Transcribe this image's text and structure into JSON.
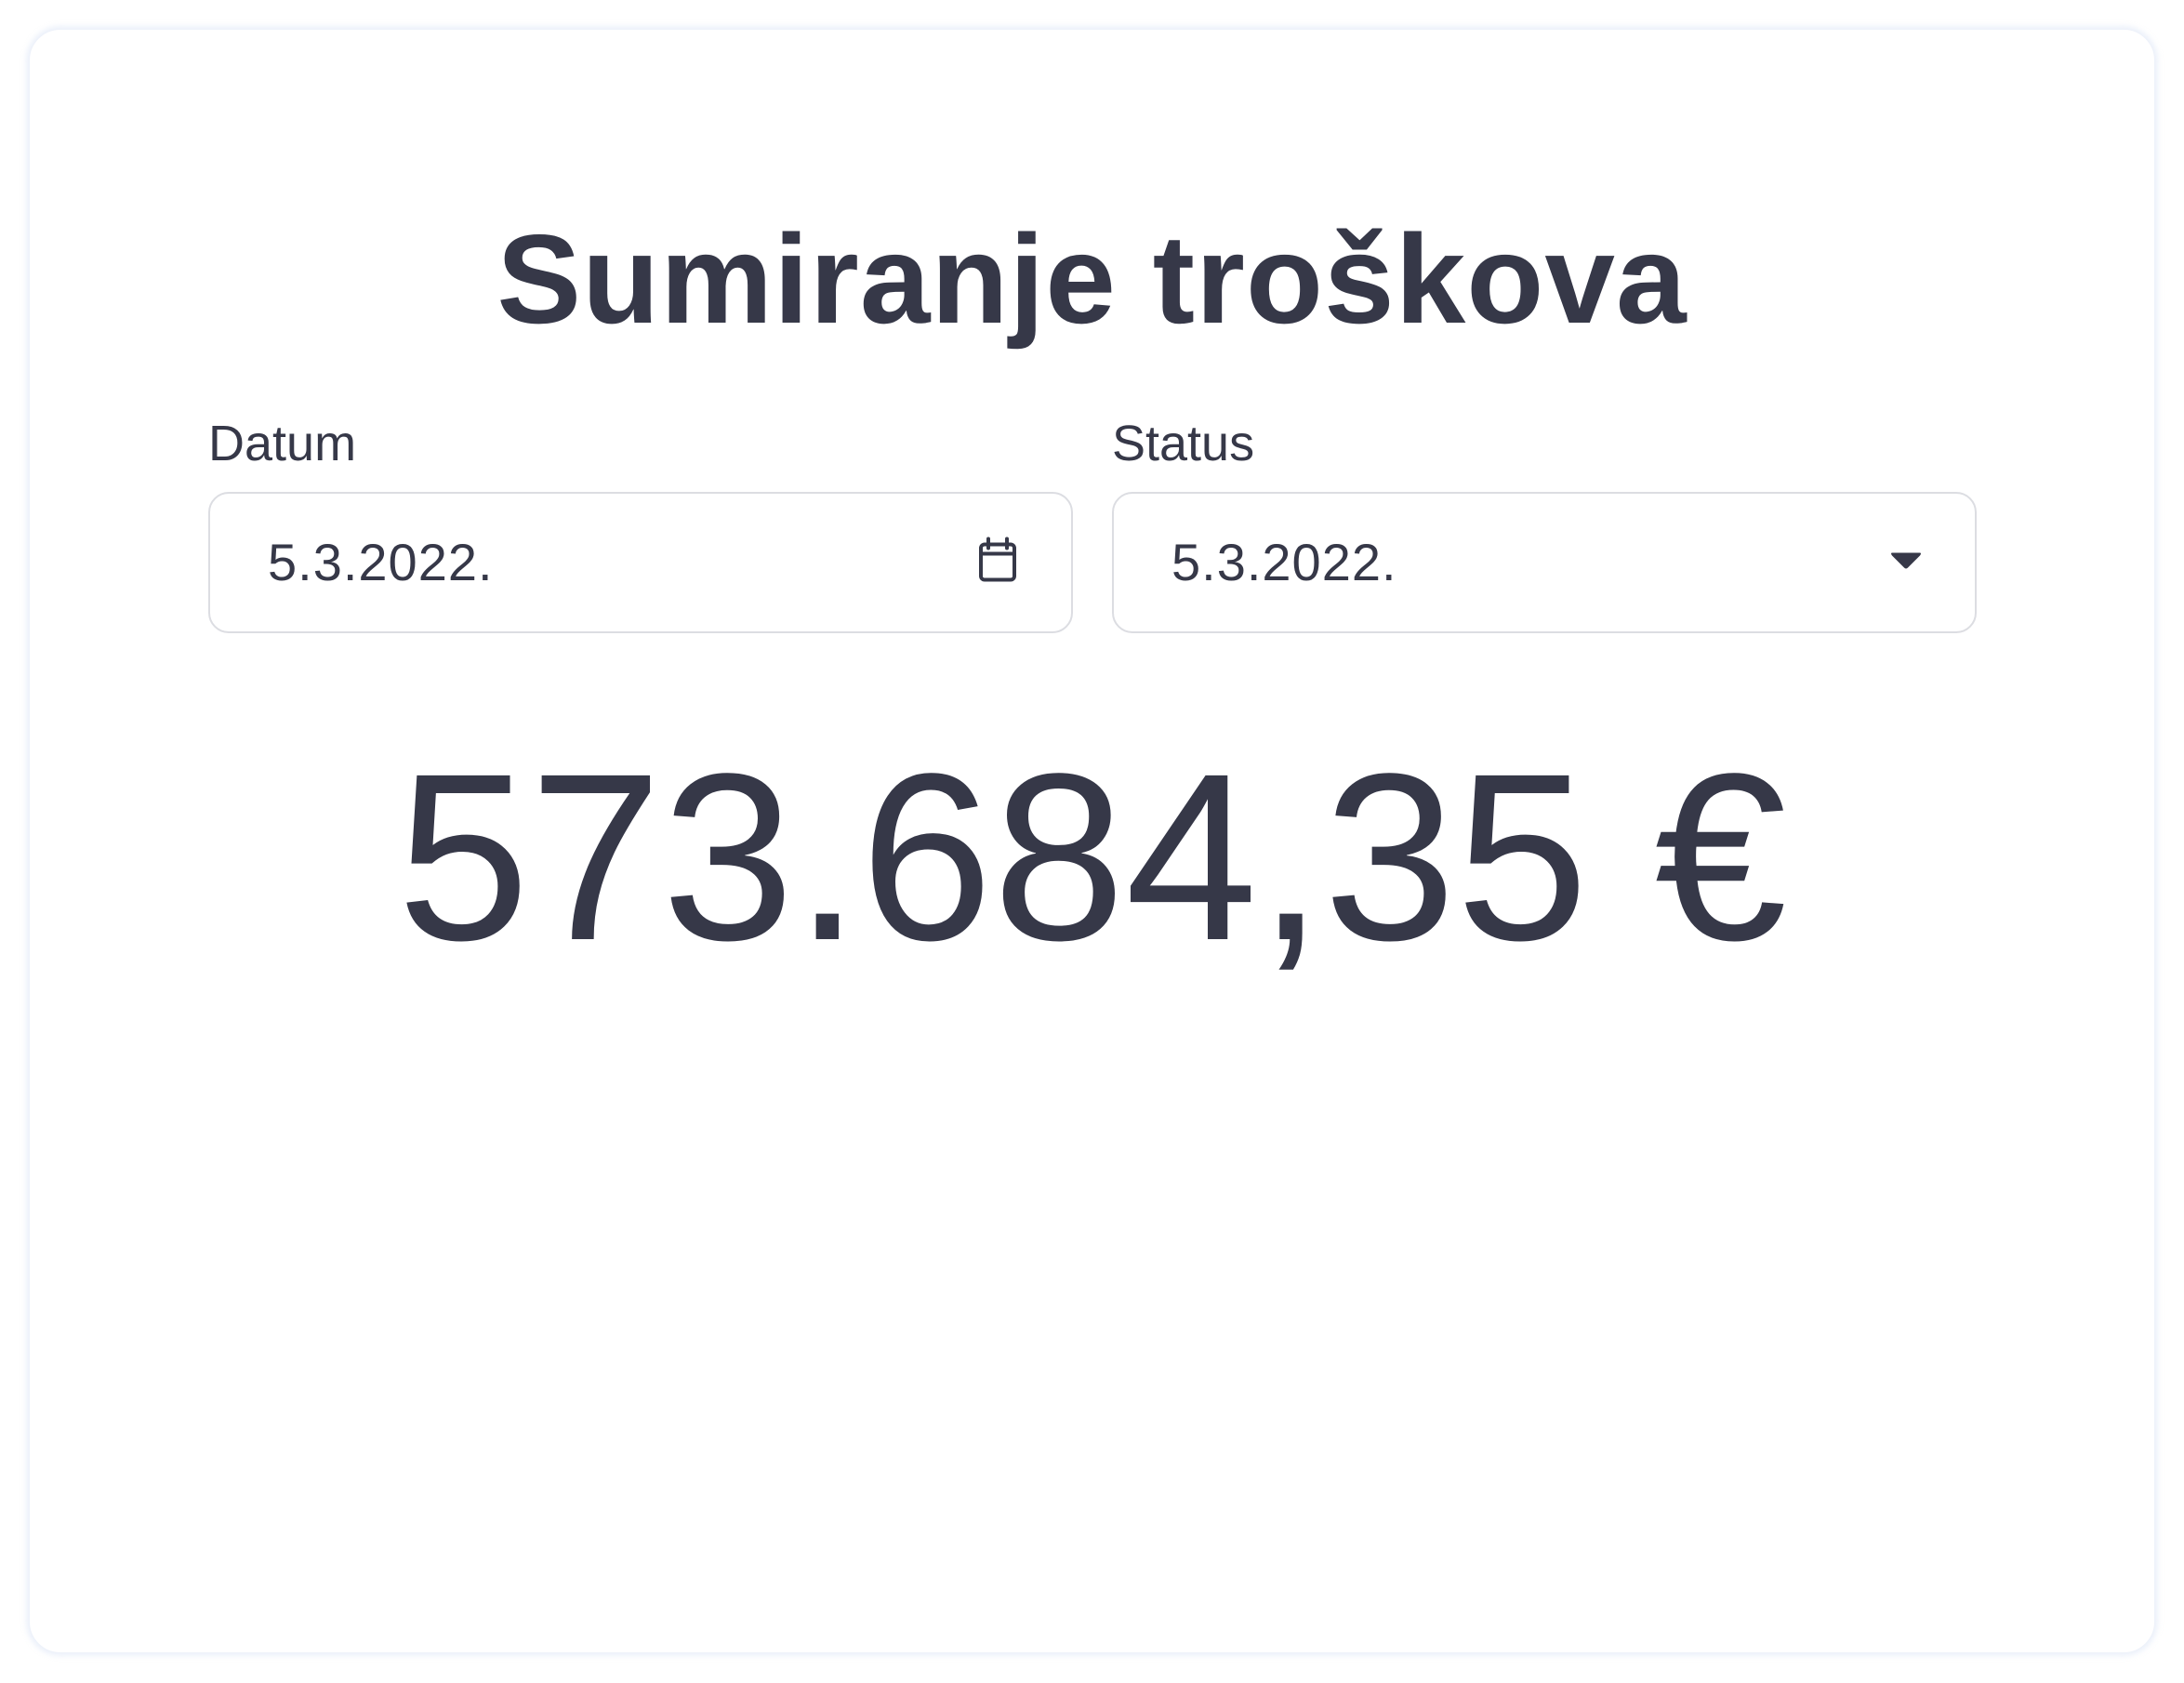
{
  "page": {
    "title": "Sumiranje troškova"
  },
  "filters": {
    "date": {
      "label": "Datum",
      "value": "5.3.2022.",
      "icon": "calendar-icon"
    },
    "status": {
      "label": "Status",
      "value": "5.3.2022.",
      "icon": "caret-down-icon"
    }
  },
  "summary": {
    "total": "573.684,35 €"
  },
  "colors": {
    "text": "#363848",
    "border": "#dcdde2",
    "background": "#ffffff"
  }
}
